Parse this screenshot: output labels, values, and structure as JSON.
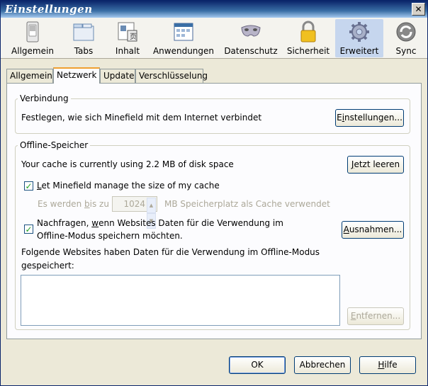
{
  "window": {
    "title": "Einstellungen",
    "close_label": "✕"
  },
  "toolbar": {
    "items": [
      {
        "label": "Allgemein",
        "icon": "switch-icon"
      },
      {
        "label": "Tabs",
        "icon": "tabs-icon"
      },
      {
        "label": "Inhalt",
        "icon": "content-icon"
      },
      {
        "label": "Anwendungen",
        "icon": "applications-icon"
      },
      {
        "label": "Datenschutz",
        "icon": "mask-icon"
      },
      {
        "label": "Sicherheit",
        "icon": "lock-icon"
      },
      {
        "label": "Erweitert",
        "icon": "gear-icon"
      },
      {
        "label": "Sync",
        "icon": "sync-icon"
      }
    ]
  },
  "tabs": {
    "allgemein": "Allgemein",
    "netzwerk": "Netzwerk",
    "update": "Update",
    "verschluesselung": "Verschlüsselung"
  },
  "verbindung": {
    "legend": "Verbindung",
    "description": "Festlegen, wie sich Minefield mit dem Internet verbindet",
    "settings_button_pre": "E",
    "settings_button_ul": "i",
    "settings_button_post": "nstellungen..."
  },
  "offline": {
    "legend": "Offline-Speicher",
    "cache_text": "Your cache is currently using 2.2 MB of disk space",
    "clear_button_pre": "J",
    "clear_button_ul": "e",
    "clear_button_post": "tzt leeren",
    "manage_checkbox_pre": "",
    "manage_checkbox_ul": "L",
    "manage_checkbox_post": "et Minefield manage the size of my cache",
    "limit_pre": "Es werden ",
    "limit_ul": "b",
    "limit_post": "is zu",
    "limit_value": "1024",
    "limit_suffix": "MB Speicherplatz als Cache verwendet",
    "ask_line1_pre": "Nachfragen, ",
    "ask_line1_ul": "w",
    "ask_line1_post": "enn Websites Daten für die Verwendung im",
    "ask_line2": "Offline-Modus speichern möchten.",
    "exceptions_button_pre": "",
    "exceptions_button_ul": "A",
    "exceptions_button_post": "usnahmen...",
    "list_label_line1": "Folgende Websites haben Daten für die Verwendung im Offline-Modus",
    "list_label_line2": "gespeichert:",
    "remove_button_pre": "",
    "remove_button_ul": "E",
    "remove_button_post": "ntfernen..."
  },
  "footer": {
    "ok": "OK",
    "cancel": "Abbrechen",
    "help_ul": "H",
    "help_post": "ilfe"
  }
}
